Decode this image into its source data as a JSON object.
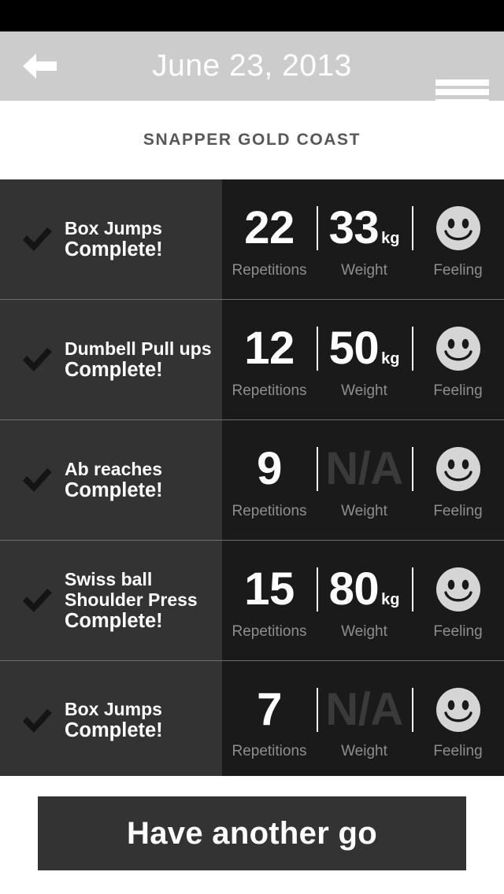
{
  "header": {
    "title": "June 23, 2013",
    "back_icon": "back-arrow-icon",
    "menu_icon": "hamburger-menu-icon"
  },
  "subtitle": "SNAPPER GOLD COAST",
  "stat_labels": {
    "repetitions": "Repetitions",
    "weight": "Weight",
    "feeling": "Feeling"
  },
  "status_text": "Complete!",
  "weight_unit": "kg",
  "not_available": "N/A",
  "feeling_icon": "smiley-face-icon",
  "check_icon": "checkmark-icon",
  "colors": {
    "status_bar": "#000000",
    "header_bar": "#cccccc",
    "panel_left": "#333333",
    "panel_right": "#1a1a1a",
    "divider": "#6e6e6e",
    "label_gray": "#8e8e8e",
    "na_gray": "#3a3a3a",
    "subtitle_gray": "#58585a",
    "button_bg": "#333333"
  },
  "exercises": [
    {
      "name": "Box Jumps",
      "status": "Complete!",
      "repetitions": "22",
      "weight": "33",
      "unit": "kg",
      "has_weight": true,
      "feeling": "happy"
    },
    {
      "name": "Dumbell Pull ups",
      "status": "Complete!",
      "repetitions": "12",
      "weight": "50",
      "unit": "kg",
      "has_weight": true,
      "feeling": "happy"
    },
    {
      "name": "Ab reaches",
      "status": "Complete!",
      "repetitions": "9",
      "weight": "N/A",
      "unit": "",
      "has_weight": false,
      "feeling": "happy"
    },
    {
      "name": "Swiss ball Shoulder Press",
      "name_line1": "Swiss ball",
      "name_line2": "Shoulder Press",
      "status": "Complete!",
      "repetitions": "15",
      "weight": "80",
      "unit": "kg",
      "has_weight": true,
      "feeling": "happy"
    },
    {
      "name": "Box Jumps",
      "status": "Complete!",
      "repetitions": "7",
      "weight": "N/A",
      "unit": "",
      "has_weight": false,
      "feeling": "happy"
    }
  ],
  "footer": {
    "again_label": "Have another go"
  }
}
